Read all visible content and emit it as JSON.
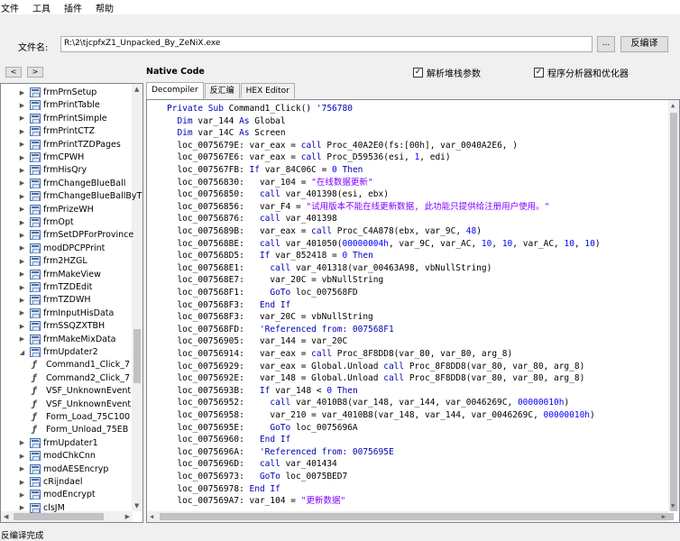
{
  "menu": [
    "文件",
    "工具",
    "插件",
    "帮助"
  ],
  "file": {
    "label": "文件名:",
    "path": "R:\\2\\tjcpfxZ1_Unpacked_By_ZeNiX.exe",
    "browse_label": "...",
    "decompile_label": "反编译"
  },
  "options": {
    "back": "<",
    "forward": ">",
    "native_code": "Native Code",
    "parse_stack": "解析堆栈参数",
    "analyzer": "程序分析器和优化器"
  },
  "tree": [
    {
      "label": "frmPrnSetup",
      "type": "form",
      "indent": 0,
      "expander": "▶"
    },
    {
      "label": "frmPrintTable",
      "type": "form",
      "indent": 0,
      "expander": "▶"
    },
    {
      "label": "frmPrintSimple",
      "type": "form",
      "indent": 0,
      "expander": "▶"
    },
    {
      "label": "frmPrintCTZ",
      "type": "form",
      "indent": 0,
      "expander": "▶"
    },
    {
      "label": "frmPrintTZDPages",
      "type": "form",
      "indent": 0,
      "expander": "▶"
    },
    {
      "label": "frmCPWH",
      "type": "form",
      "indent": 0,
      "expander": "▶"
    },
    {
      "label": "frmHisQry",
      "type": "form",
      "indent": 0,
      "expander": "▶"
    },
    {
      "label": "frmChangeBlueBall",
      "type": "form",
      "indent": 0,
      "expander": "▶"
    },
    {
      "label": "frmChangeBlueBallByT",
      "type": "form",
      "indent": 0,
      "expander": "▶"
    },
    {
      "label": "frmPrizeWH",
      "type": "form",
      "indent": 0,
      "expander": "▶"
    },
    {
      "label": "frmOpt",
      "type": "form",
      "indent": 0,
      "expander": "▶"
    },
    {
      "label": "frmSetDPForProvince",
      "type": "form",
      "indent": 0,
      "expander": "▶"
    },
    {
      "label": "modDPCPPrint",
      "type": "form",
      "indent": 0,
      "expander": "▶"
    },
    {
      "label": "frm2HZGL",
      "type": "form",
      "indent": 0,
      "expander": "▶"
    },
    {
      "label": "frmMakeView",
      "type": "form",
      "indent": 0,
      "expander": "▶"
    },
    {
      "label": "frmTZDEdit",
      "type": "form",
      "indent": 0,
      "expander": "▶"
    },
    {
      "label": "frmTZDWH",
      "type": "form",
      "indent": 0,
      "expander": "▶"
    },
    {
      "label": "frmInputHisData",
      "type": "form",
      "indent": 0,
      "expander": "▶"
    },
    {
      "label": "frmSSQZXTBH",
      "type": "form",
      "indent": 0,
      "expander": "▶"
    },
    {
      "label": "frmMakeMixData",
      "type": "form",
      "indent": 0,
      "expander": "▶"
    },
    {
      "label": "frmUpdater2",
      "type": "form",
      "indent": 0,
      "expander": "◢"
    },
    {
      "label": "Command1_Click_7",
      "type": "fn",
      "indent": 1,
      "expander": ""
    },
    {
      "label": "Command2_Click_7",
      "type": "fn",
      "indent": 1,
      "expander": ""
    },
    {
      "label": "VSF_UnknownEvent",
      "type": "fn",
      "indent": 1,
      "expander": ""
    },
    {
      "label": "VSF_UnknownEvent",
      "type": "fn",
      "indent": 1,
      "expander": ""
    },
    {
      "label": "Form_Load_75C100",
      "type": "fn",
      "indent": 1,
      "expander": ""
    },
    {
      "label": "Form_Unload_75EB",
      "type": "fn",
      "indent": 1,
      "expander": ""
    },
    {
      "label": "frmUpdater1",
      "type": "form",
      "indent": 0,
      "expander": "▶"
    },
    {
      "label": "modChkCnn",
      "type": "form",
      "indent": 0,
      "expander": "▶"
    },
    {
      "label": "modAESEncryp",
      "type": "form",
      "indent": 0,
      "expander": "▶"
    },
    {
      "label": "cRijndael",
      "type": "form",
      "indent": 0,
      "expander": "▶"
    },
    {
      "label": "modEncrypt",
      "type": "form",
      "indent": 0,
      "expander": "▶"
    },
    {
      "label": "clsJM",
      "type": "form",
      "indent": 0,
      "expander": "▶"
    }
  ],
  "tabs": [
    "Decompiler",
    "反汇编",
    "HEX Editor"
  ],
  "code": [
    [
      [
        "kw",
        "Private Sub "
      ],
      [
        "",
        "Command1_Click() "
      ],
      [
        "cm",
        "'756780"
      ]
    ],
    [
      [
        "",
        "  "
      ],
      [
        "kw",
        "Dim"
      ],
      [
        "",
        " var_144 "
      ],
      [
        "kw",
        "As"
      ],
      [
        "",
        " Global"
      ]
    ],
    [
      [
        "",
        "  "
      ],
      [
        "kw",
        "Dim"
      ],
      [
        "",
        " var_14C "
      ],
      [
        "kw",
        "As"
      ],
      [
        "",
        " Screen"
      ]
    ],
    [
      [
        "",
        "  loc_0075679E: var_eax = "
      ],
      [
        "kw",
        "call"
      ],
      [
        "",
        " Proc_40A2E0(fs:[00h], var_0040A2E6, )"
      ]
    ],
    [
      [
        "",
        "  loc_007567E6: var_eax = "
      ],
      [
        "kw",
        "call"
      ],
      [
        "",
        " Proc_D59536(esi, "
      ],
      [
        "num",
        "1"
      ],
      [
        "",
        ", edi)"
      ]
    ],
    [
      [
        "",
        "  loc_007567FB: "
      ],
      [
        "kw",
        "If"
      ],
      [
        "",
        " var_84C06C = "
      ],
      [
        "num",
        "0"
      ],
      [
        "",
        " "
      ],
      [
        "kw",
        "Then"
      ]
    ],
    [
      [
        "",
        "  loc_00756830:   var_104 = "
      ],
      [
        "str",
        "\"在线数据更新\""
      ]
    ],
    [
      [
        "",
        "  loc_00756850:   "
      ],
      [
        "kw",
        "call"
      ],
      [
        "",
        " var_401398(esi, ebx)"
      ]
    ],
    [
      [
        "",
        "  loc_00756856:   var_F4 = "
      ],
      [
        "str",
        "\"试用版本不能在线更新数据, 此功能只提供给注册用户使用。\""
      ]
    ],
    [
      [
        "",
        "  loc_00756876:   "
      ],
      [
        "kw",
        "call"
      ],
      [
        "",
        " var_401398"
      ]
    ],
    [
      [
        "",
        "  loc_0075689B:   var_eax = "
      ],
      [
        "kw",
        "call"
      ],
      [
        "",
        " Proc_C4A878(ebx, var_9C, "
      ],
      [
        "num",
        "48"
      ],
      [
        "",
        ")"
      ]
    ],
    [
      [
        "",
        "  loc_007568BE:   "
      ],
      [
        "kw",
        "call"
      ],
      [
        "",
        " var_401050("
      ],
      [
        "num",
        "00000004h"
      ],
      [
        "",
        ", var_9C, var_AC, "
      ],
      [
        "num",
        "10"
      ],
      [
        "",
        ", "
      ],
      [
        "num",
        "10"
      ],
      [
        "",
        ", var_AC, "
      ],
      [
        "num",
        "10"
      ],
      [
        "",
        ", "
      ],
      [
        "num",
        "10"
      ],
      [
        "",
        ")"
      ]
    ],
    [
      [
        "",
        "  loc_007568D5:   "
      ],
      [
        "kw",
        "If"
      ],
      [
        "",
        " var_852418 = "
      ],
      [
        "num",
        "0"
      ],
      [
        "",
        " "
      ],
      [
        "kw",
        "Then"
      ]
    ],
    [
      [
        "",
        "  loc_007568E1:     "
      ],
      [
        "kw",
        "call"
      ],
      [
        "",
        " var_401318(var_00463A98, vbNullString)"
      ]
    ],
    [
      [
        "",
        "  loc_007568E7:     var_20C = vbNullString"
      ]
    ],
    [
      [
        "",
        "  loc_007568F1:     "
      ],
      [
        "kw",
        "GoTo"
      ],
      [
        "",
        " loc_007568FD"
      ]
    ],
    [
      [
        "",
        "  loc_007568F3:   "
      ],
      [
        "kw",
        "End If"
      ]
    ],
    [
      [
        "",
        "  loc_007568F3:   var_20C = vbNullString"
      ]
    ],
    [
      [
        "",
        "  loc_007568FD:   "
      ],
      [
        "cm",
        "'Referenced from: 007568F1"
      ]
    ],
    [
      [
        "",
        "  loc_00756905:   var_144 = var_20C"
      ]
    ],
    [
      [
        "",
        "  loc_00756914:   var_eax = "
      ],
      [
        "kw",
        "call"
      ],
      [
        "",
        " Proc_8F8DD8(var_80, var_80, arg_8)"
      ]
    ],
    [
      [
        "",
        "  loc_00756929:   var_eax = Global.Unload "
      ],
      [
        "kw",
        "call"
      ],
      [
        "",
        " Proc_8F8DD8(var_80, var_80, arg_8)"
      ]
    ],
    [
      [
        "",
        "  loc_0075692E:   var_148 = Global.Unload "
      ],
      [
        "kw",
        "call"
      ],
      [
        "",
        " Proc_8F8DD8(var_80, var_80, arg_8)"
      ]
    ],
    [
      [
        "",
        "  loc_0075693B:   "
      ],
      [
        "kw",
        "If"
      ],
      [
        "",
        " var_148 < "
      ],
      [
        "num",
        "0"
      ],
      [
        "",
        " "
      ],
      [
        "kw",
        "Then"
      ]
    ],
    [
      [
        "",
        "  loc_00756952:     "
      ],
      [
        "kw",
        "call"
      ],
      [
        "",
        " var_4010B8(var_148, var_144, var_0046269C, "
      ],
      [
        "num",
        "00000010h"
      ],
      [
        "",
        ")"
      ]
    ],
    [
      [
        "",
        "  loc_00756958:     var_210 = var_4010B8(var_148, var_144, var_0046269C, "
      ],
      [
        "num",
        "00000010h"
      ],
      [
        "",
        ")"
      ]
    ],
    [
      [
        "",
        "  loc_0075695E:     "
      ],
      [
        "kw",
        "GoTo"
      ],
      [
        "",
        " loc_0075696A"
      ]
    ],
    [
      [
        "",
        "  loc_00756960:   "
      ],
      [
        "kw",
        "End If"
      ]
    ],
    [
      [
        "",
        "  loc_0075696A:   "
      ],
      [
        "cm",
        "'Referenced from: 0075695E"
      ]
    ],
    [
      [
        "",
        "  loc_0075696D:   "
      ],
      [
        "kw",
        "call"
      ],
      [
        "",
        " var_401434"
      ]
    ],
    [
      [
        "",
        "  loc_00756973:   "
      ],
      [
        "kw",
        "GoTo"
      ],
      [
        "",
        " loc_0075BED7"
      ]
    ],
    [
      [
        "",
        "  loc_00756978: "
      ],
      [
        "kw",
        "End If"
      ]
    ],
    [
      [
        "",
        "  loc_007569A7: var_104 = "
      ],
      [
        "str",
        "\"更新数据\""
      ]
    ]
  ],
  "status": "反编译完成"
}
